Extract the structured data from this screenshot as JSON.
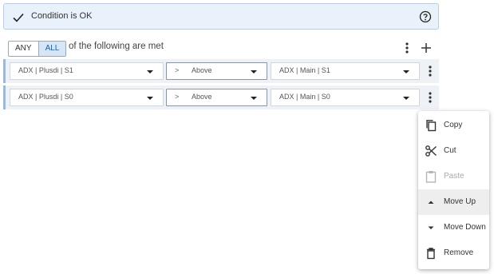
{
  "status": {
    "icon": "check-icon",
    "text": "Condition is OK",
    "help_icon": "help-circle-icon"
  },
  "match": {
    "options": [
      "ANY",
      "ALL"
    ],
    "selected": "ALL",
    "text": "of the following are met"
  },
  "conditions": [
    {
      "left": "ADX | Plusdi | S1",
      "operator_symbol": ">",
      "operator": "Above",
      "right": "ADX | Main | S1"
    },
    {
      "left": "ADX | Plusdi | S0",
      "operator_symbol": ">",
      "operator": "Above",
      "right": "ADX | Main | S0"
    }
  ],
  "context_menu": {
    "items": [
      {
        "label": "Copy",
        "icon": "copy-icon",
        "enabled": true
      },
      {
        "label": "Cut",
        "icon": "scissors-icon",
        "enabled": true
      },
      {
        "label": "Paste",
        "icon": "clipboard-icon",
        "enabled": false
      },
      {
        "label": "Move Up",
        "icon": "caret-up-icon",
        "enabled": true,
        "highlighted": true
      },
      {
        "label": "Move Down",
        "icon": "caret-down-icon",
        "enabled": true
      },
      {
        "label": "Remove",
        "icon": "trash-icon",
        "enabled": true
      }
    ]
  },
  "colors": {
    "banner_bg": "#e9f1fb",
    "banner_border": "#b9cde6",
    "row_bg": "#eef2f7",
    "row_accent": "#9db8d8",
    "active_toggle_bg": "#d6e6f7",
    "active_toggle_text": "#1f5fa8"
  }
}
